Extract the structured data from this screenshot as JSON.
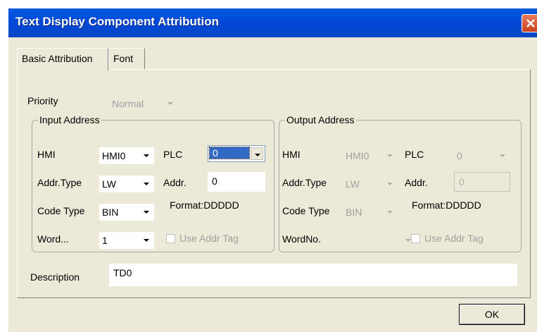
{
  "window": {
    "title": "Text Display Component Attribution",
    "close_icon": "close-icon"
  },
  "tabs": [
    {
      "label": "Basic Attribution"
    },
    {
      "label": "Font"
    }
  ],
  "priority": {
    "label": "Priority",
    "value": "Normal"
  },
  "input": {
    "group_label": "Input Address",
    "hmi_label": "HMI",
    "hmi_value": "HMI0",
    "plc_label": "PLC",
    "plc_value": "0",
    "addr_type_label": "Addr.Type",
    "addr_type_value": "LW",
    "addr_label": "Addr.",
    "addr_value": "0",
    "code_type_label": "Code Type",
    "code_type_value": "BIN",
    "format": "Format:DDDDD",
    "word_label": "Word...",
    "word_value": "1",
    "use_addr_tag": "Use Addr Tag"
  },
  "output": {
    "group_label": "Output Address",
    "hmi_label": "HMI",
    "hmi_value": "HMI0",
    "plc_label": "PLC",
    "plc_value": "0",
    "addr_type_label": "Addr.Type",
    "addr_type_value": "LW",
    "addr_label": "Addr.",
    "addr_value": "0",
    "code_type_label": "Code Type",
    "code_type_value": "BIN",
    "format": "Format:DDDDD",
    "word_label": "WordNo.",
    "word_value": "",
    "use_addr_tag": "Use Addr Tag"
  },
  "description": {
    "label": "Description",
    "value": "TD0"
  },
  "buttons": {
    "ok": "OK"
  },
  "colors": {
    "titlebar": "#0047d6",
    "dialog_bg": "#ece9d8",
    "selection": "#316ac5"
  }
}
